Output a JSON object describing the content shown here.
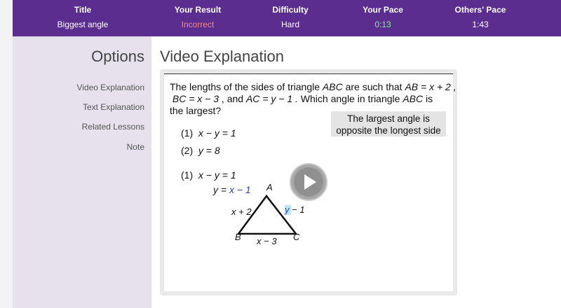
{
  "header": {
    "columns": [
      {
        "label": "Title",
        "value": "Biggest angle"
      },
      {
        "label": "Your Result",
        "value": "Incorrect",
        "color": "#f08a8a"
      },
      {
        "label": "Difficulty",
        "value": "Hard"
      },
      {
        "label": "Your Pace",
        "value": "0:13",
        "color": "#8fe3a0"
      },
      {
        "label": "Others' Pace",
        "value": "1:43"
      }
    ]
  },
  "sidebar": {
    "title": "Options",
    "items": [
      "Video Explanation",
      "Text Explanation",
      "Related Lessons",
      "Note"
    ]
  },
  "main": {
    "title": "Video Explanation",
    "question": {
      "line1_a": "The lengths of the sides of triangle ",
      "abc1": "ABC",
      "line1_b": " are such that ",
      "ab_eq": "AB = x + 2 ,",
      "bc_eq": "BC = x − 3",
      "line2_b": " , and ",
      "ac_eq": "AC = y − 1 .",
      "line2_c": "  Which angle in triangle ",
      "abc2": "ABC",
      "line2_d": " is",
      "line3": "the largest?"
    },
    "hint_line1": "The largest angle is",
    "hint_line2": "opposite the longest side",
    "statements": [
      {
        "num": "(1)",
        "expr": "x − y = 1"
      },
      {
        "num": "(2)",
        "expr": "y = 8"
      }
    ],
    "work": {
      "num": "(1)",
      "eq1": "x − y = 1",
      "eq2_left": "y = ",
      "eq2_right": "x − 1",
      "vertex_a": "A",
      "vertex_b": "B",
      "vertex_c": "C",
      "side_ab": "x + 2",
      "side_ac_var": "y",
      "side_ac_rest": " − 1",
      "side_bc": "x − 3"
    },
    "play_icon": "play-icon"
  }
}
